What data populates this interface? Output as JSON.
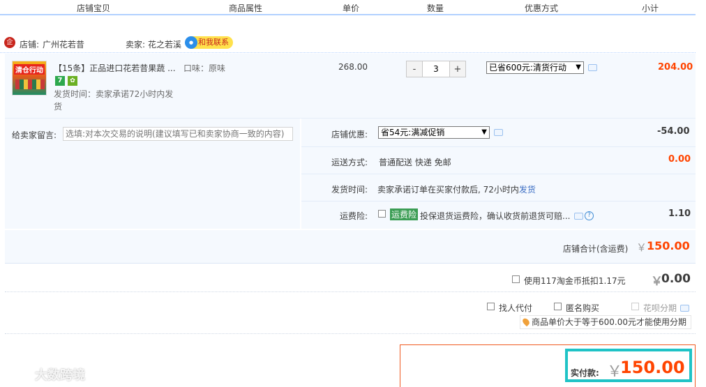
{
  "columns": [
    "店铺宝贝",
    "商品属性",
    "单价",
    "数量",
    "优惠方式",
    "小计"
  ],
  "shop": {
    "icon_label": "企",
    "shop_prefix": "店铺:",
    "shop_name": "广州花若昔",
    "seller_prefix": "卖家:",
    "seller_name": "花之若溪",
    "contact_label": "和我联系"
  },
  "item": {
    "thumb_text": "清仓行动",
    "title": "【15条】正品进口花若昔果蔬 ...",
    "tag_seven": "7",
    "shipping_note": "发货时间：卖家承诺72小时内发货",
    "attribute": "口味：原味",
    "unit_price": "268.00",
    "quantity": "3",
    "qty_minus": "-",
    "qty_plus": "+",
    "discount_option": "已省600元:清货行动",
    "subtotal": "204.00"
  },
  "details": {
    "remark_label": "给卖家留言:",
    "remark_placeholder": "选填:对本次交易的说明(建议填写已和卖家协商一致的内容)",
    "shop_discount_label": "店铺优惠:",
    "shop_discount_option": "省54元:满减促销",
    "shop_discount_value": "-54.00",
    "delivery_label": "运送方式:",
    "delivery_value": "普通配送 快递 免邮",
    "delivery_amount": "0.00",
    "ship_time_label": "发货时间:",
    "ship_time_text": "卖家承诺订单在买家付款后, 72小时内",
    "ship_time_link": "发货",
    "insurance_label": "运费险:",
    "insurance_tag": "运费险",
    "insurance_text": "投保退货运费险，确认收货前退货可赔...",
    "insurance_amount": "1.10"
  },
  "shop_total": {
    "label": "店铺合计(含运费)",
    "currency": "￥",
    "value": "150.00"
  },
  "coins": {
    "label": "使用117淘金币抵扣1.17元",
    "currency": "￥",
    "value": "0.00"
  },
  "options": {
    "proxy_pay": "找人代付",
    "anonymous": "匿名购买",
    "huabei": "花呗分期",
    "huabei_tip": "商品单价大于等于600.00元才能使用分期"
  },
  "payment": {
    "label": "实付款:",
    "currency": "￥",
    "value": "150.00"
  },
  "watermark": "大数跨境",
  "colors": {
    "accent": "#ff4400",
    "border_blue": "#b2d1ff",
    "teal_highlight": "#1fc3c6",
    "bg_light": "#f5f9fe"
  }
}
